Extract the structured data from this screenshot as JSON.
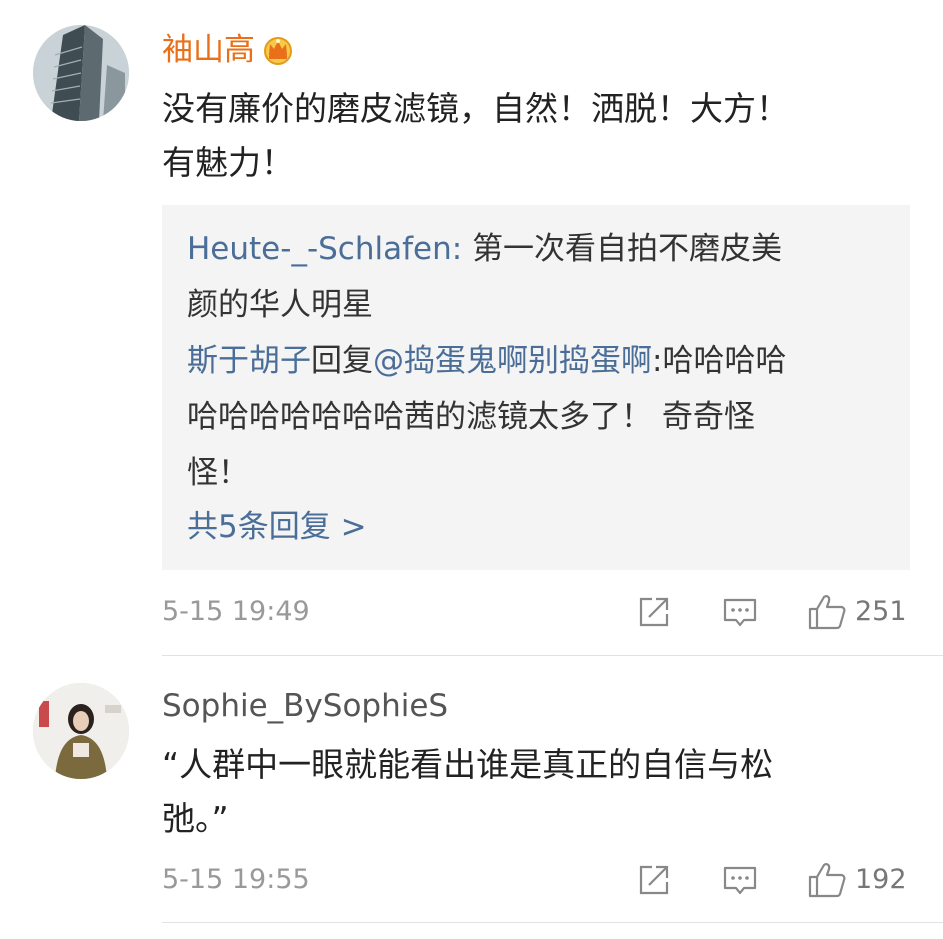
{
  "comments": [
    {
      "username": "袖山高",
      "has_vip_badge": true,
      "text_lines": [
        "没有廉价的磨皮滤镜，自然！洒脱！大方！",
        "有魅力！"
      ],
      "replies": [
        {
          "author": "Heute-_-Schlafen",
          "separator": ": ",
          "text_first": "第一次看自拍不磨皮美",
          "text_rest": [
            "颜的华人明星"
          ]
        },
        {
          "author": "斯于胡子",
          "reply_word": "回复",
          "mention": "@捣蛋鬼啊别捣蛋啊",
          "separator": ":",
          "text_first": "哈哈哈哈",
          "text_rest": [
            "哈哈哈哈哈哈哈茜的滤镜太多了！ 奇奇怪",
            "怪！"
          ]
        }
      ],
      "more_replies": "共5条回复 >",
      "timestamp": "5-15 19:49",
      "likes": "251",
      "icons": [
        "share-icon",
        "comment-icon",
        "like-icon"
      ]
    },
    {
      "username": "Sophie_BySophieS",
      "has_vip_badge": false,
      "text_lines": [
        "“人群中一眼就能看出谁是真正的自信与松",
        "弛。”"
      ],
      "timestamp": "5-15 19:55",
      "likes": "192",
      "icons": [
        "share-icon",
        "comment-icon",
        "like-icon"
      ]
    }
  ],
  "colors": {
    "vip_name": "#e8701a",
    "link_blue": "#4a6e98",
    "meta_gray": "#999999",
    "reply_bg": "#f4f4f4"
  }
}
